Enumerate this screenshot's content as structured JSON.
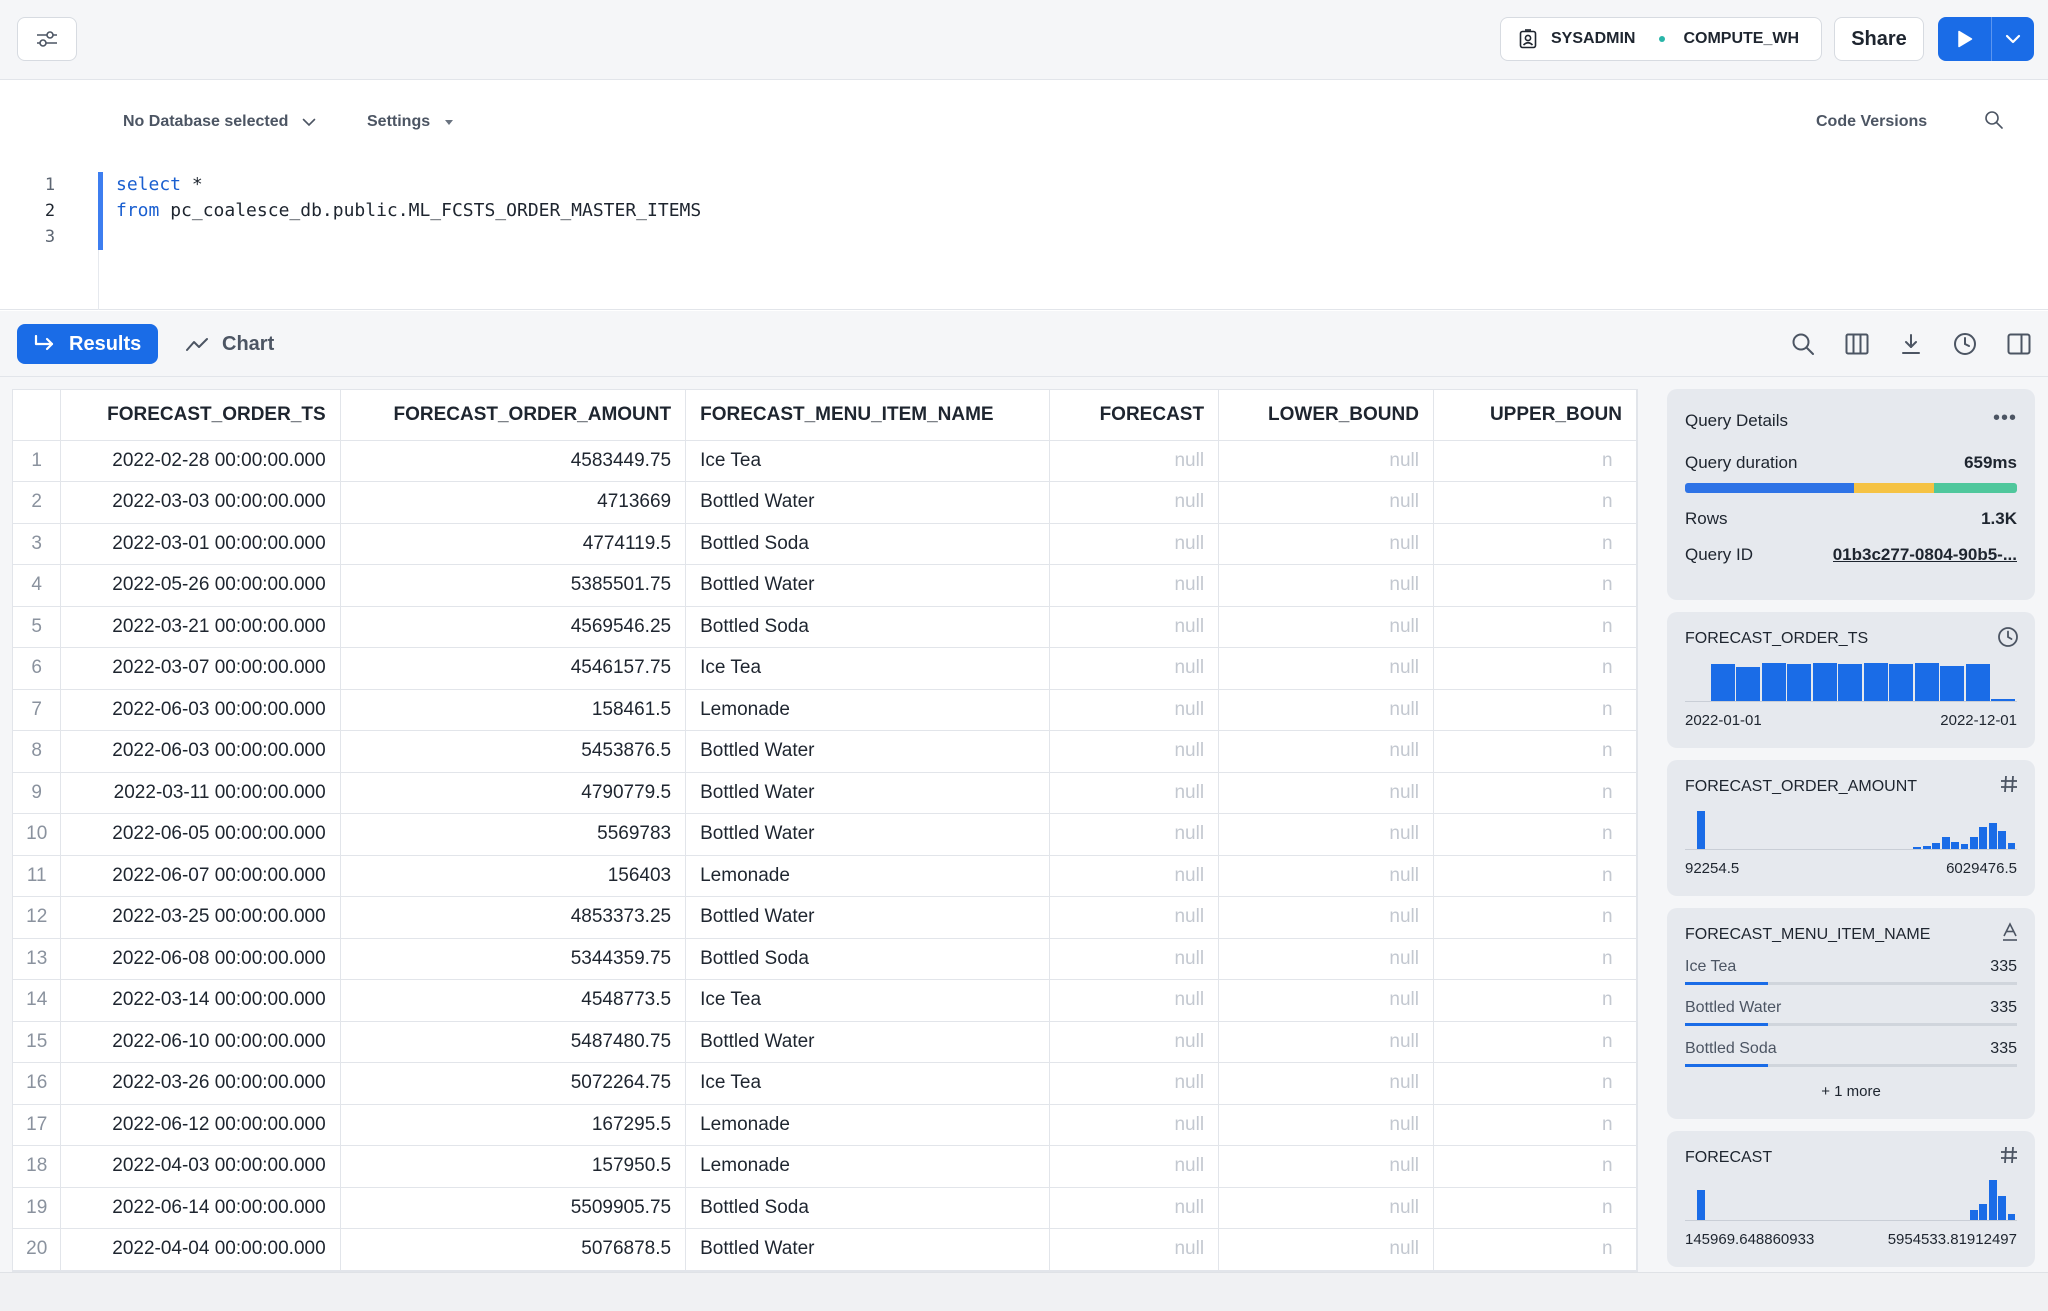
{
  "topbar": {
    "role": "SYSADMIN",
    "warehouse": "COMPUTE_WH",
    "share_label": "Share"
  },
  "editor": {
    "database_label": "No Database selected",
    "settings_label": "Settings",
    "code_versions_label": "Code Versions",
    "line_numbers": [
      "1",
      "2",
      "3"
    ],
    "lines": [
      {
        "kw": "select",
        "rest": " *"
      },
      {
        "kw": "from",
        "rest": " pc_coalesce_db.public.ML_FCSTS_ORDER_MASTER_ITEMS"
      },
      {
        "kw": "",
        "rest": ""
      }
    ]
  },
  "tabs": {
    "results_label": "Results",
    "chart_label": "Chart"
  },
  "table": {
    "columns": [
      "FORECAST_ORDER_TS",
      "FORECAST_ORDER_AMOUNT",
      "FORECAST_MENU_ITEM_NAME",
      "FORECAST",
      "LOWER_BOUND",
      "UPPER_BOUN"
    ],
    "null_text": "null",
    "partial_null_text": "n",
    "rows": [
      {
        "idx": "1",
        "ts": "2022-02-28 00:00:00.000",
        "amount": "4583449.75",
        "name": "Ice Tea"
      },
      {
        "idx": "2",
        "ts": "2022-03-03 00:00:00.000",
        "amount": "4713669",
        "name": "Bottled Water"
      },
      {
        "idx": "3",
        "ts": "2022-03-01 00:00:00.000",
        "amount": "4774119.5",
        "name": "Bottled Soda"
      },
      {
        "idx": "4",
        "ts": "2022-05-26 00:00:00.000",
        "amount": "5385501.75",
        "name": "Bottled Water"
      },
      {
        "idx": "5",
        "ts": "2022-03-21 00:00:00.000",
        "amount": "4569546.25",
        "name": "Bottled Soda"
      },
      {
        "idx": "6",
        "ts": "2022-03-07 00:00:00.000",
        "amount": "4546157.75",
        "name": "Ice Tea"
      },
      {
        "idx": "7",
        "ts": "2022-06-03 00:00:00.000",
        "amount": "158461.5",
        "name": "Lemonade"
      },
      {
        "idx": "8",
        "ts": "2022-06-03 00:00:00.000",
        "amount": "5453876.5",
        "name": "Bottled Water"
      },
      {
        "idx": "9",
        "ts": "2022-03-11 00:00:00.000",
        "amount": "4790779.5",
        "name": "Bottled Water"
      },
      {
        "idx": "10",
        "ts": "2022-06-05 00:00:00.000",
        "amount": "5569783",
        "name": "Bottled Water"
      },
      {
        "idx": "11",
        "ts": "2022-06-07 00:00:00.000",
        "amount": "156403",
        "name": "Lemonade"
      },
      {
        "idx": "12",
        "ts": "2022-03-25 00:00:00.000",
        "amount": "4853373.25",
        "name": "Bottled Water"
      },
      {
        "idx": "13",
        "ts": "2022-06-08 00:00:00.000",
        "amount": "5344359.75",
        "name": "Bottled Soda"
      },
      {
        "idx": "14",
        "ts": "2022-03-14 00:00:00.000",
        "amount": "4548773.5",
        "name": "Ice Tea"
      },
      {
        "idx": "15",
        "ts": "2022-06-10 00:00:00.000",
        "amount": "5487480.75",
        "name": "Bottled Water"
      },
      {
        "idx": "16",
        "ts": "2022-03-26 00:00:00.000",
        "amount": "5072264.75",
        "name": "Ice Tea"
      },
      {
        "idx": "17",
        "ts": "2022-06-12 00:00:00.000",
        "amount": "167295.5",
        "name": "Lemonade"
      },
      {
        "idx": "18",
        "ts": "2022-04-03 00:00:00.000",
        "amount": "157950.5",
        "name": "Lemonade"
      },
      {
        "idx": "19",
        "ts": "2022-06-14 00:00:00.000",
        "amount": "5509905.75",
        "name": "Bottled Soda"
      },
      {
        "idx": "20",
        "ts": "2022-04-04 00:00:00.000",
        "amount": "5076878.5",
        "name": "Bottled Water"
      }
    ]
  },
  "details": {
    "title": "Query Details",
    "duration_label": "Query duration",
    "duration_value": "659ms",
    "rows_label": "Rows",
    "rows_value": "1.3K",
    "query_id_label": "Query ID",
    "query_id_value": "01b3c277-0804-90b5-..."
  },
  "column_stats": {
    "ts": {
      "name": "FORECAST_ORDER_TS",
      "min": "2022-01-01",
      "max": "2022-12-01",
      "histogram": [
        0,
        0.92,
        0.85,
        0.95,
        0.92,
        0.95,
        0.92,
        0.95,
        0.92,
        0.95,
        0.88,
        0.92,
        0.04
      ]
    },
    "amount": {
      "name": "FORECAST_ORDER_AMOUNT",
      "min": "92254.5",
      "max": "6029476.5",
      "histogram": [
        0.95,
        0,
        0,
        0,
        0,
        0,
        0,
        0,
        0,
        0,
        0,
        0,
        0,
        0,
        0,
        0,
        0,
        0,
        0,
        0,
        0,
        0,
        0,
        0.05,
        0.08,
        0.15,
        0.3,
        0.18,
        0.12,
        0.3,
        0.55,
        0.65,
        0.45,
        0.15
      ]
    },
    "menu": {
      "name": "FORECAST_MENU_ITEM_NAME",
      "items": [
        {
          "label": "Ice Tea",
          "count": "335",
          "share": 0.25
        },
        {
          "label": "Bottled Water",
          "count": "335",
          "share": 0.25
        },
        {
          "label": "Bottled Soda",
          "count": "335",
          "share": 0.25
        }
      ],
      "more": "+ 1 more"
    },
    "forecast": {
      "name": "FORECAST",
      "min": "145969.648860933",
      "max": "5954533.81912497",
      "histogram": [
        0.75,
        0,
        0,
        0,
        0,
        0,
        0,
        0,
        0,
        0,
        0,
        0,
        0,
        0,
        0,
        0,
        0,
        0,
        0,
        0,
        0,
        0,
        0,
        0,
        0,
        0,
        0,
        0,
        0,
        0.25,
        0.4,
        1.0,
        0.6,
        0.15
      ]
    }
  }
}
